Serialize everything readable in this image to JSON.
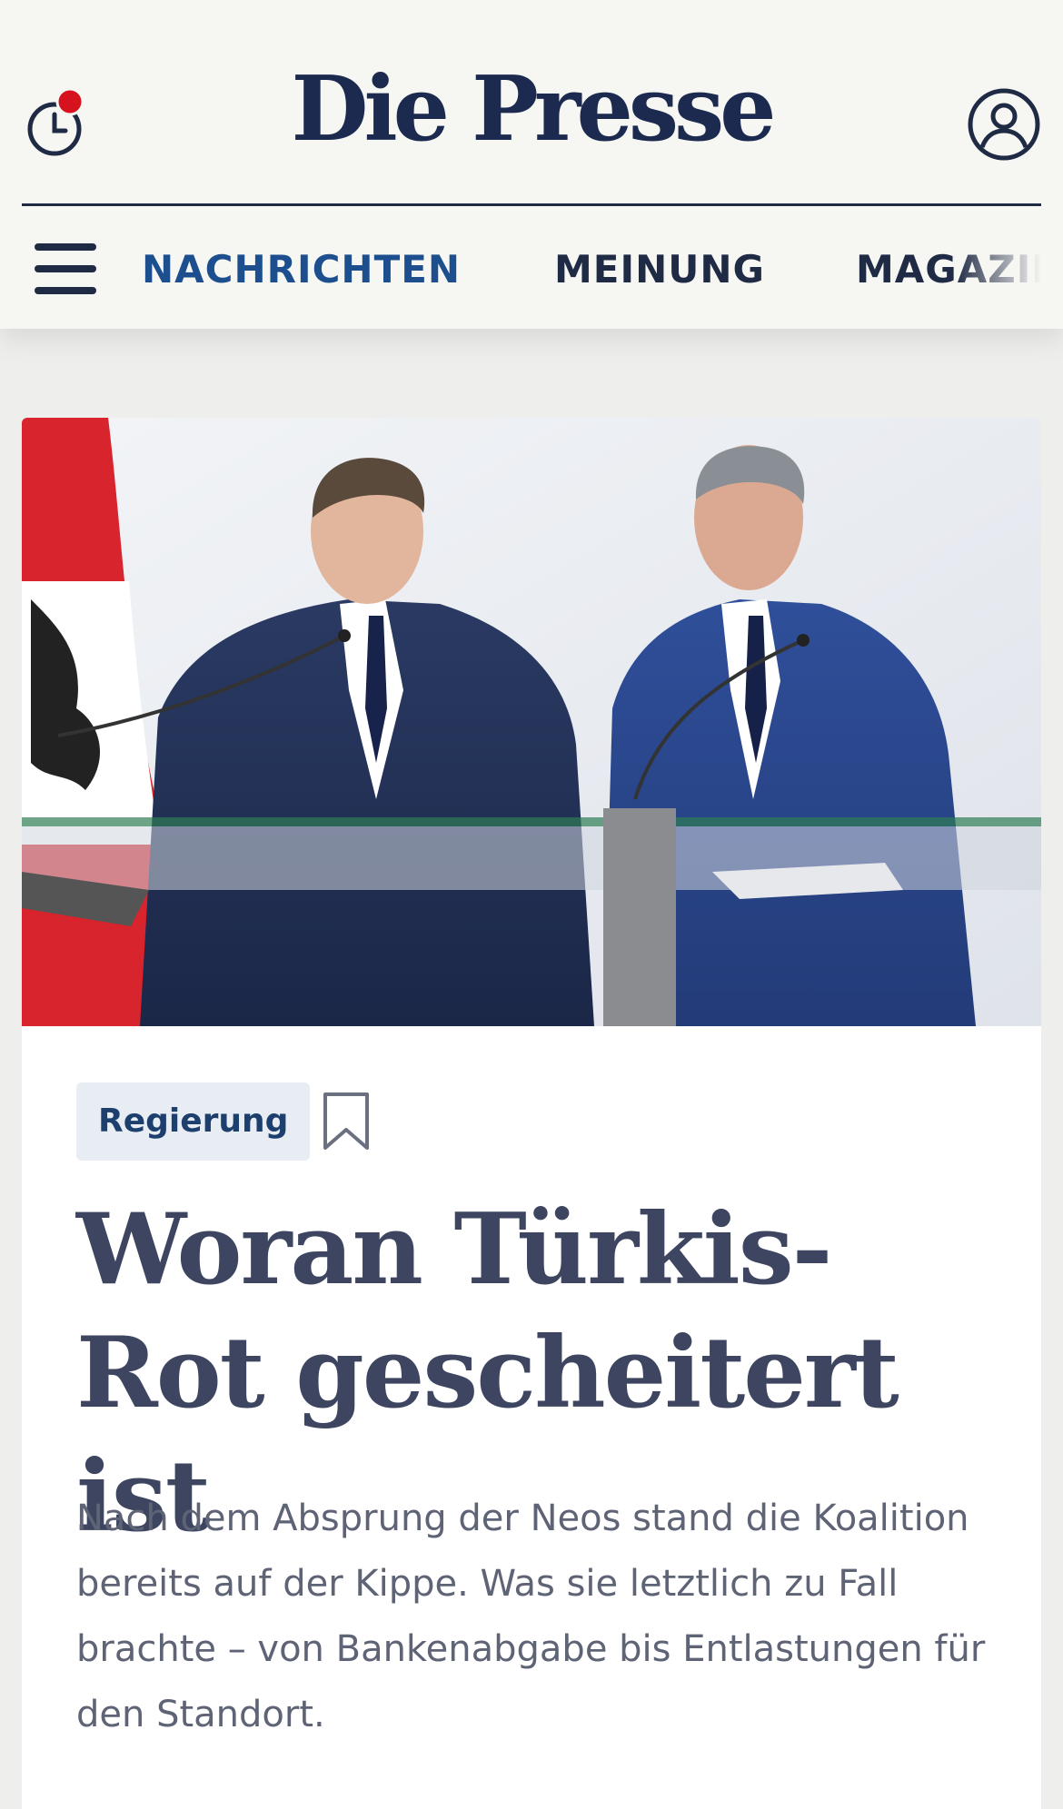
{
  "header": {
    "logo": "Die Presse",
    "history_icon": "clock-icon",
    "notification_dot_color": "#d6121f",
    "account_icon": "user-icon",
    "menu_icon": "hamburger-icon"
  },
  "nav": {
    "items": [
      {
        "label": "NACHRICHTEN",
        "active": true
      },
      {
        "label": "MEINUNG",
        "active": false
      },
      {
        "label": "MAGAZIN",
        "active": false
      }
    ]
  },
  "article": {
    "category": "Regierung",
    "bookmark_icon": "bookmark-icon",
    "headline": "Woran Türkis-Rot gescheitert ist",
    "lead": "Nach dem Absprung der Neos stand die Koalition bereits auf der Kippe. Was sie letztlich zu Fall brachte – von Bankenabgabe bis Entlastungen für den Standort."
  },
  "colors": {
    "brand": "#1b2a4e",
    "nav_active": "#1d4f8f",
    "tag_bg": "#e8edf3",
    "tag_text": "#1d3f6e",
    "headline": "#3d4560",
    "lead": "#5e6475"
  }
}
